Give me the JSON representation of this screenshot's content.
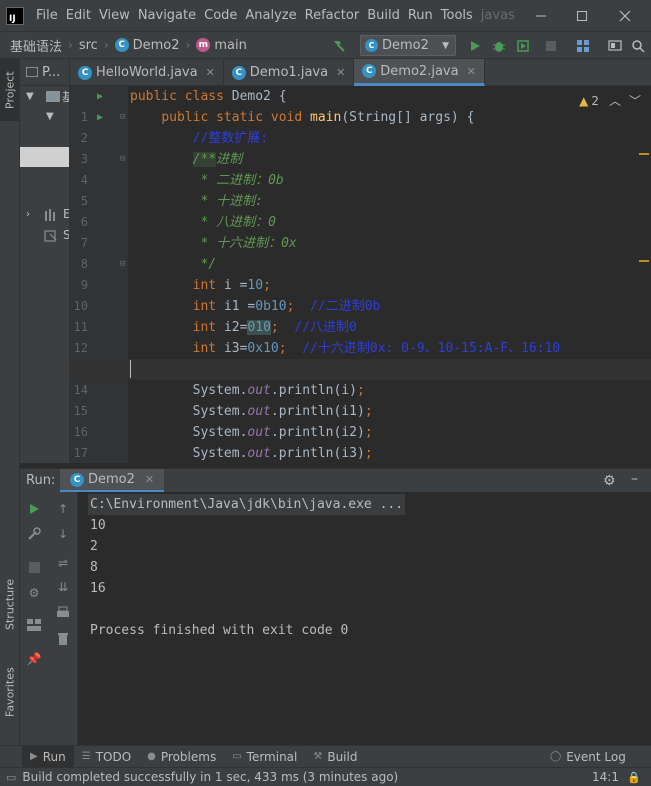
{
  "menubar": {
    "items": [
      "File",
      "Edit",
      "View",
      "Navigate",
      "Code",
      "Analyze",
      "Refactor",
      "Build",
      "Run",
      "Tools"
    ],
    "project_name": "javas",
    "logo": "IJ"
  },
  "navbar": {
    "crumbs": [
      "基础语法",
      "src",
      "Demo2",
      "main"
    ],
    "run_config": "Demo2"
  },
  "left_strip": {
    "top_tab": "Project",
    "structure_tab": "Structure",
    "favorites_tab": "Favorites"
  },
  "project_panel": {
    "title": "P...",
    "row1": "基",
    "row2": "E",
    "row3": "S"
  },
  "editor_tabs": [
    {
      "label": "HelloWorld.java"
    },
    {
      "label": "Demo1.java"
    },
    {
      "label": "Demo2.java"
    }
  ],
  "inspection": {
    "count": "2"
  },
  "code_lines": [
    {
      "n": "1",
      "text": "public class Demo2 {"
    },
    {
      "n": "2",
      "text": "    public static void main(String[] args) {"
    },
    {
      "n": "3",
      "text": "        //整数扩展:"
    },
    {
      "n": "4",
      "text": "        /**进制"
    },
    {
      "n": "5",
      "text": "         * 二进制：0b"
    },
    {
      "n": "6",
      "text": "         * 十进制:"
    },
    {
      "n": "7",
      "text": "         * 八进制：0"
    },
    {
      "n": "8",
      "text": "         * 十六进制：0x"
    },
    {
      "n": "9",
      "text": "         */"
    },
    {
      "n": "10",
      "text": "        int i =10;"
    },
    {
      "n": "11",
      "text": "        int i1 =0b10;  //二进制0b"
    },
    {
      "n": "12",
      "text": "        int i2=010;  //八进制0"
    },
    {
      "n": "13",
      "text": "        int i3=0x10;  //十六进制0x: 0-9、10-15:A-F、16:10"
    },
    {
      "n": "14",
      "text": ""
    },
    {
      "n": "15",
      "text": "        System.out.println(i);"
    },
    {
      "n": "16",
      "text": "        System.out.println(i1);"
    },
    {
      "n": "17",
      "text": "        System.out.println(i2);"
    },
    {
      "n": "18",
      "text": "        System.out.println(i3);"
    }
  ],
  "run_panel": {
    "label": "Run:",
    "tab": "Demo2",
    "console": {
      "command": "C:\\Environment\\Java\\jdk\\bin\\java.exe ...",
      "outputs": [
        "10",
        "2",
        "8",
        "16"
      ],
      "exit_message": "Process finished with exit code 0"
    }
  },
  "bottom_tabs": [
    {
      "label": "Run",
      "icon": "run-icon"
    },
    {
      "label": "TODO",
      "icon": "todo-icon"
    },
    {
      "label": "Problems",
      "icon": "problems-icon"
    },
    {
      "label": "Terminal",
      "icon": "terminal-icon"
    },
    {
      "label": "Build",
      "icon": "build-icon"
    }
  ],
  "event_log": "Event Log",
  "status": {
    "message": "Build completed successfully in 1 sec, 433 ms (3 minutes ago)",
    "position": "14:1"
  },
  "colors": {
    "accent": "#4a88c7",
    "keyword": "#cc7832",
    "number": "#6897bb",
    "comment": "#2f3ed8",
    "doc_comment": "#629755",
    "run_green": "#499c54"
  }
}
